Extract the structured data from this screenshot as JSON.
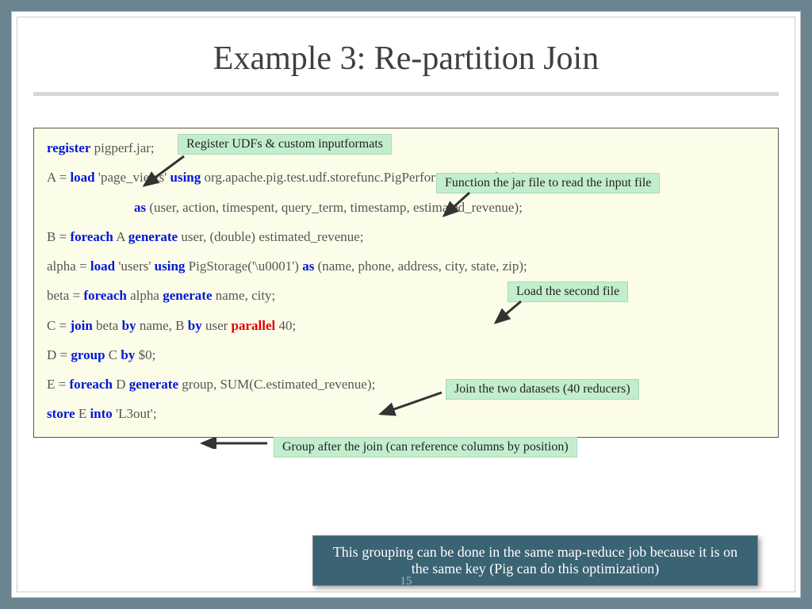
{
  "title": "Example 3: Re-partition Join",
  "page_number": "15",
  "annotations": {
    "a1": "Register UDFs & custom inputformats",
    "a2": "Function the jar file to read the input file",
    "a3": "Load the second file",
    "a4": "Join the two datasets (40 reducers)",
    "a5": "Group after the join (can reference columns by position)"
  },
  "callout": "This grouping can be done in the same map-reduce job because it is on the same key (Pig can do this optimization)",
  "code": {
    "kw_register": "register",
    "l1_rest": " pigperf.jar;",
    "l2a": "A = ",
    "kw_load": "load",
    "l2b": " 'page_views' ",
    "kw_using": "using",
    "l2c": " org.apache.pig.test.udf.storefunc.PigPerformanceLoader()",
    "kw_as": "as",
    "l3": " (user, action, timespent, query_term, timestamp, estimated_revenue);",
    "l4a": "B = ",
    "kw_foreach": "foreach",
    "l4b": " A ",
    "kw_generate": "generate",
    "l4c": " user, (double) estimated_revenue;",
    "l5a": "alpha = ",
    "l5b": " 'users' ",
    "l5c": " PigStorage('\\u0001') ",
    "l5d": " (name, phone, address, city, state, zip);",
    "l6a": "beta = ",
    "l6b": " alpha ",
    "l6c": " name, city;",
    "l7a": "C = ",
    "kw_join": "join",
    "l7b": " beta ",
    "kw_by": "by",
    "l7c": " name, B ",
    "l7d": " user ",
    "kw_parallel": "parallel",
    "l7e": " 40;",
    "l8a": "D = ",
    "kw_group": "group",
    "l8b": " C ",
    "l8c": " $0;",
    "l9a": "E = ",
    "l9b": " D ",
    "l9c": " group, SUM(C.estimated_revenue);",
    "kw_store": "store",
    "l10a": " E ",
    "kw_into": "into",
    "l10b": " 'L3out';"
  }
}
